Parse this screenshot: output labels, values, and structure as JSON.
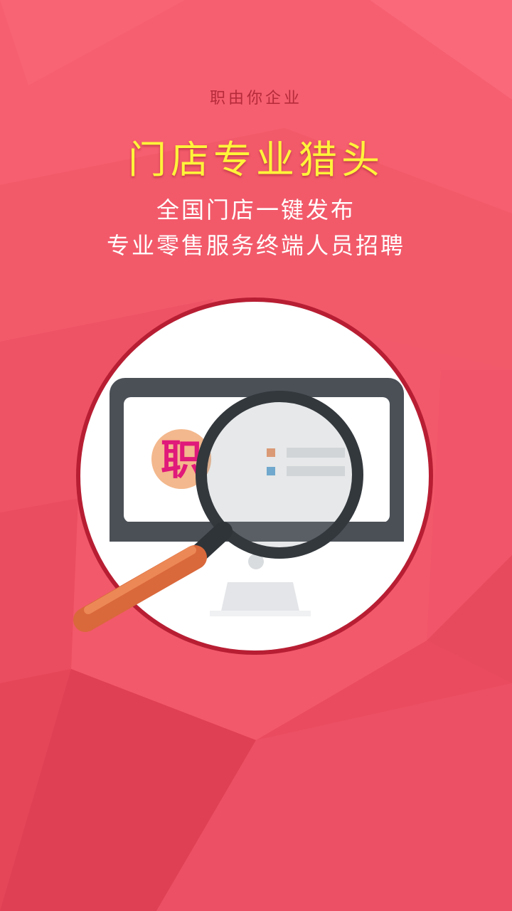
{
  "splash": {
    "tagline": "职由你企业",
    "headline": "门店专业猎头",
    "subline_1": "全国门店一键发布",
    "subline_2": "专业零售服务终端人员招聘"
  },
  "illustration": {
    "logo_glyph": "职",
    "icons": [
      "monitor-icon",
      "magnifier-icon",
      "list-icon"
    ]
  },
  "colors": {
    "background": "#f2596a",
    "headline": "#fff43a",
    "tagline": "#b52a3a",
    "ring": "#b81e33",
    "logo_badge": "#f3b88d",
    "logo_text": "#e0197a",
    "magnifier_handle": "#e2774a",
    "monitor_frame": "#4b5057"
  }
}
